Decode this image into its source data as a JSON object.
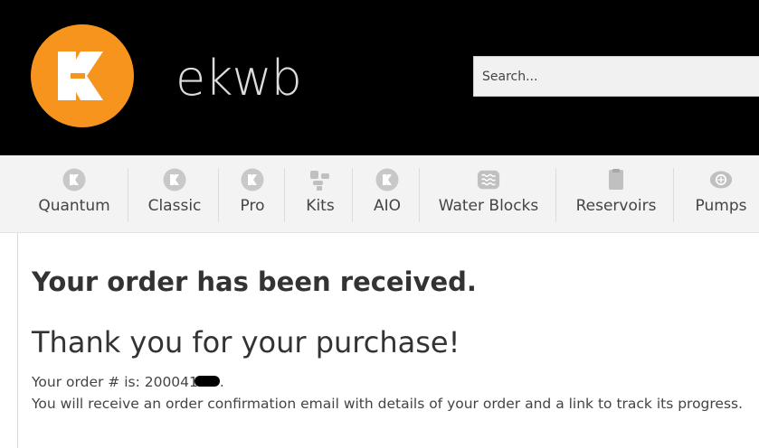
{
  "brand": {
    "name": "ekwb",
    "accent": "#f7941d"
  },
  "search": {
    "placeholder": "Search..."
  },
  "nav": {
    "items": [
      {
        "label": "Quantum",
        "icon": "ek-logo-icon"
      },
      {
        "label": "Classic",
        "icon": "ek-logo-icon"
      },
      {
        "label": "Pro",
        "icon": "ek-logo-icon"
      },
      {
        "label": "Kits",
        "icon": "kits-icon"
      },
      {
        "label": "AIO",
        "icon": "ek-logo-icon"
      },
      {
        "label": "Water Blocks",
        "icon": "water-block-icon"
      },
      {
        "label": "Reservoirs",
        "icon": "reservoir-icon"
      },
      {
        "label": "Pumps",
        "icon": "pump-icon"
      }
    ]
  },
  "order": {
    "heading": "Your order has been received.",
    "thanks": "Thank you for your purchase!",
    "order_number_prefix": "Your order # is: 200041",
    "order_number_suffix": ".",
    "confirmation_text": "You will receive an order confirmation email with details of your order and a link to track its progress."
  }
}
